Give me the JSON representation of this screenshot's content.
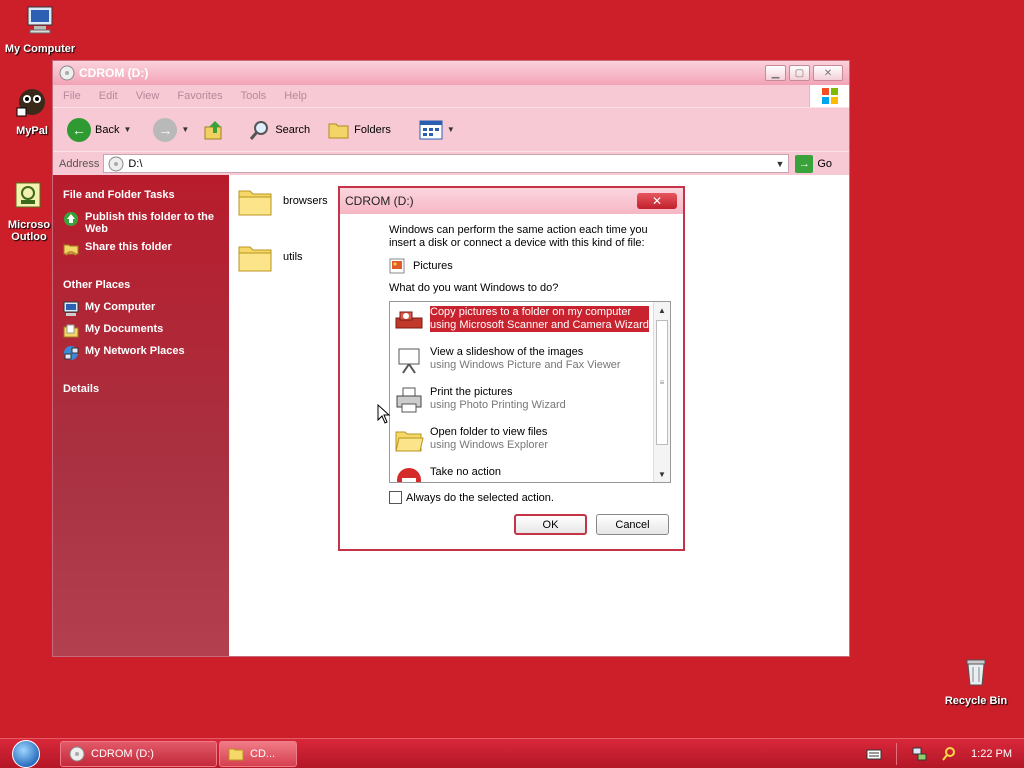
{
  "desktop": {
    "icons": [
      {
        "label": "My Computer"
      },
      {
        "label": "MyPal"
      },
      {
        "label": "Microso\nOutloo"
      },
      {
        "label": "Recycle Bin"
      }
    ]
  },
  "explorer": {
    "title": "CDROM (D:)",
    "menu": [
      "File",
      "Edit",
      "View",
      "Favorites",
      "Tools",
      "Help"
    ],
    "toolbar": {
      "back_label": "Back",
      "search_label": "Search",
      "folders_label": "Folders"
    },
    "address": {
      "label": "Address",
      "value": "D:\\",
      "go_label": "Go"
    },
    "taskpane": {
      "file_folder_tasks": {
        "heading": "File and Folder Tasks",
        "items": [
          "Publish this folder to the Web",
          "Share this folder"
        ]
      },
      "other_places": {
        "heading": "Other Places",
        "items": [
          "My Computer",
          "My Documents",
          "My Network Places"
        ]
      },
      "details": {
        "heading": "Details"
      }
    },
    "files": [
      {
        "name": "browsers"
      },
      {
        "name": "utils"
      }
    ]
  },
  "dialog": {
    "title": "CDROM (D:)",
    "close_label": "✕",
    "intro": "Windows can perform the same action each time you insert a disk or connect a device with this kind of file:",
    "content_type": "Pictures",
    "question": "What do you want Windows to do?",
    "options": [
      {
        "title": "Copy pictures to a folder on my computer",
        "sub": "using Microsoft Scanner and Camera Wizard",
        "selected": true
      },
      {
        "title": "View a slideshow of the images",
        "sub": "using Windows Picture and Fax Viewer",
        "selected": false
      },
      {
        "title": "Print the pictures",
        "sub": "using Photo Printing Wizard",
        "selected": false
      },
      {
        "title": "Open folder to view files",
        "sub": "using Windows Explorer",
        "selected": false
      },
      {
        "title": "Take no action",
        "sub": "",
        "selected": false
      }
    ],
    "always_label": "Always do the selected action.",
    "ok_label": "OK",
    "cancel_label": "Cancel"
  },
  "taskbar": {
    "tasks": [
      {
        "label": "CDROM (D:)"
      },
      {
        "label": "CD..."
      }
    ],
    "clock": "1:22 PM"
  },
  "colors": {
    "desktop": "#cc1f2a",
    "accent": "#c43346",
    "selection": "#c8232f"
  }
}
